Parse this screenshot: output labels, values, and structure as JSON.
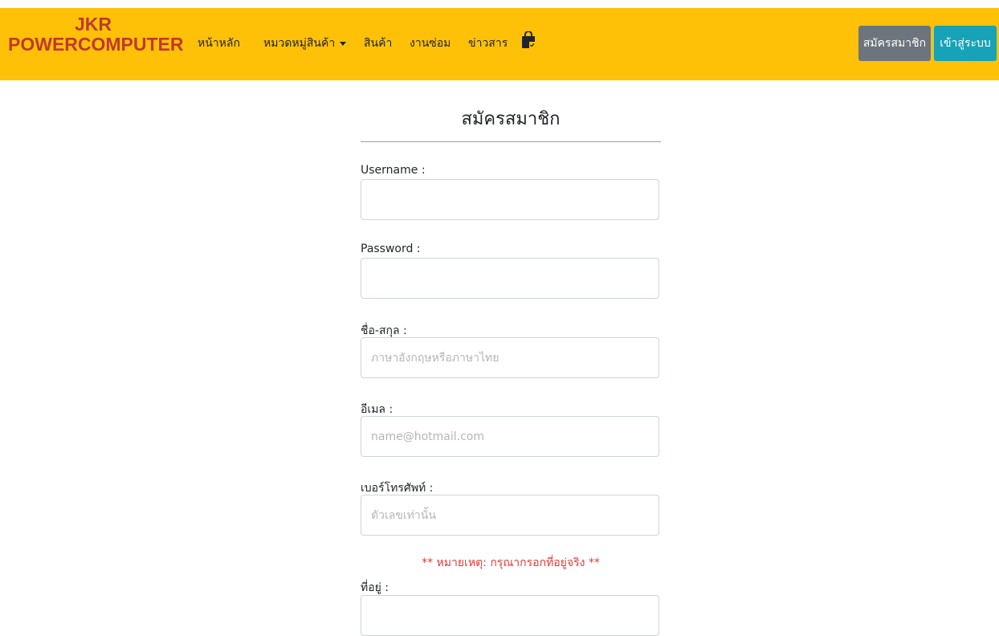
{
  "navbar": {
    "brand_line1": "JKR",
    "brand_line2": "POWERCOMPUTER",
    "links": {
      "home": "หน้าหลัก",
      "categories": "หมวดหมู่สินค้า",
      "products": "สินค้า",
      "repair": "งานซ่อม",
      "news": "ข่าวสาร"
    },
    "cart_icon": "shopping-bag-icon",
    "register_button": "สมัครสมาชิก",
    "login_button": "เข้าสู่ระบบ"
  },
  "form": {
    "title": "สมัครสมาชิก",
    "fields": {
      "username": {
        "label": "Username :",
        "value": "",
        "placeholder": ""
      },
      "password": {
        "label": "Password :",
        "value": "",
        "placeholder": ""
      },
      "fullname": {
        "label": "ชื่อ-สกุล :",
        "value": "",
        "placeholder": "ภาษาอังกฤษหรือภาษาไทย"
      },
      "email": {
        "label": "อีเมล :",
        "value": "",
        "placeholder": "name@hotmail.com"
      },
      "phone": {
        "label": "เบอร์โทรศัพท์ :",
        "value": "",
        "placeholder": "ตัวเลขเท่านั้น"
      },
      "address": {
        "label": "ที่อยู่ :",
        "value": "",
        "placeholder": ""
      }
    },
    "note": "** หมายเหตุ: กรุณากรอกที่อยู่จริง **"
  },
  "colors": {
    "navbar": "#ffc107",
    "brand": "#c0392b",
    "register_button": "#6c757d",
    "login_button": "#17a2b8",
    "note": "#e53935"
  }
}
